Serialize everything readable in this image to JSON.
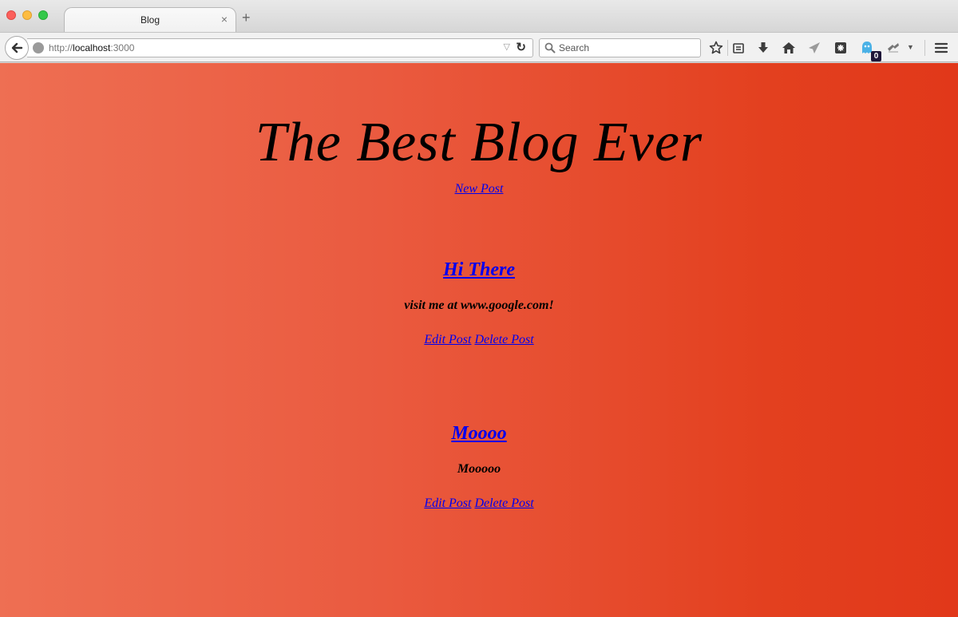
{
  "browser": {
    "tab_title": "Blog",
    "tab_close": "×",
    "new_tab": "+",
    "url_prefix": "http://",
    "url_host": "localhost",
    "url_suffix": ":3000",
    "search_placeholder": "Search",
    "ghostery_count": "0"
  },
  "page": {
    "title": "The Best Blog Ever",
    "new_post_label": "New Post",
    "posts": [
      {
        "title": "Hi There",
        "body": "visit me at www.google.com!",
        "edit_label": "Edit Post",
        "delete_label": "Delete Post"
      },
      {
        "title": "Moooo",
        "body": "Mooooo",
        "edit_label": "Edit Post",
        "delete_label": "Delete Post"
      }
    ]
  },
  "colors": {
    "background_gradient_start": "#ee6f53",
    "background_gradient_end": "#e1381a",
    "link": "#0000ee"
  },
  "icons": {
    "toolbar": [
      "bookmark-star-icon",
      "reading-list-icon",
      "download-icon",
      "home-icon",
      "send-icon",
      "extension-icon",
      "ghostery-icon",
      "adblock-icon",
      "menu-icon"
    ]
  }
}
